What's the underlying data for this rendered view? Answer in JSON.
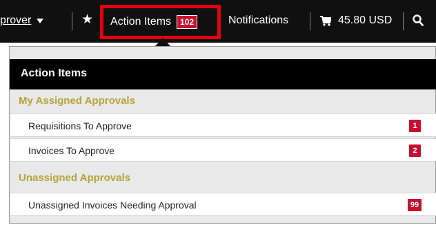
{
  "topbar": {
    "role_label": "prover",
    "action_items_label": "Action Items",
    "action_items_count": "102",
    "notifications_label": "Notifications",
    "cart_total": "45.80 USD"
  },
  "panel": {
    "title": "Action Items",
    "sections": [
      {
        "heading": "My Assigned Approvals",
        "items": [
          {
            "label": "Requisitions To Approve",
            "count": "1"
          },
          {
            "label": "Invoices To Approve",
            "count": "2"
          }
        ]
      },
      {
        "heading": "Unassigned Approvals",
        "items": [
          {
            "label": "Unassigned Invoices Needing Approval",
            "count": "99"
          }
        ]
      }
    ]
  },
  "colors": {
    "topbar_bg": "#101010",
    "highlight_border": "#e4000f",
    "badge": "#c8102e",
    "section_heading": "#b5a33a"
  },
  "icons": [
    "caret-down-icon",
    "star-icon",
    "cart-icon",
    "search-icon"
  ]
}
